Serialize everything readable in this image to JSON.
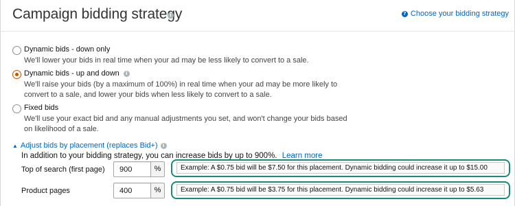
{
  "header": {
    "title": "Campaign bidding strategy",
    "info_glyph": "i",
    "help_link": "Choose your bidding strategy",
    "help_glyph": "?"
  },
  "options": [
    {
      "label": "Dynamic bids - down only",
      "description": "We'll lower your bids in real time when your ad may be less likely to convert to a sale.",
      "selected": false
    },
    {
      "label": "Dynamic bids - up and down",
      "description_line1": "We'll raise your bids (by a maximum of 100%) in real time when your ad may be more likely to",
      "description_line2": "convert to a sale, and lower your bids when less likely to convert to a sale.",
      "selected": true
    },
    {
      "label": "Fixed bids",
      "description_line1": "We'll use your exact bid and any manual adjustments you set, and won't change your bids based",
      "description_line2": "on likelihood of a sale.",
      "selected": false
    }
  ],
  "adjust": {
    "chevron": "▲",
    "label": "Adjust bids by placement (replaces Bid+)",
    "description": "In addition to your bidding strategy, you can increase bids by up to 900%.",
    "learn_more": "Learn more"
  },
  "placements": [
    {
      "label": "Top of search (first page)",
      "value": "900",
      "unit": "%",
      "example": "Example: A $0.75 bid will be $7.50 for this placement. Dynamic bidding could increase it up to $15.00"
    },
    {
      "label": "Product pages",
      "value": "400",
      "unit": "%",
      "example": "Example: A $0.75 bid will be $3.75 for this placement. Dynamic bidding could increase it up to $5.63"
    }
  ],
  "colors": {
    "link": "#0066c0",
    "radio_selected": "#c45500",
    "highlight_outline": "#178a7a"
  }
}
